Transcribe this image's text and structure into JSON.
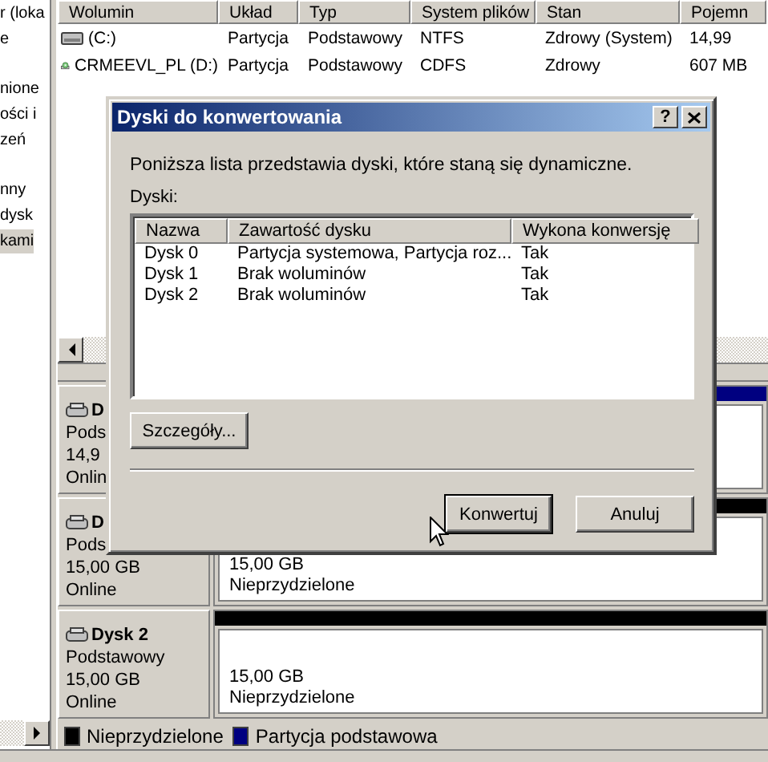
{
  "tree": {
    "items": [
      {
        "label": "r (loka",
        "selected": false
      },
      {
        "label": "e",
        "selected": false
      },
      {
        "label": "nione",
        "selected": false
      },
      {
        "label": "ości i",
        "selected": false
      },
      {
        "label": "zeń",
        "selected": false
      },
      {
        "label": "nny",
        "selected": false
      },
      {
        "label": "dysk",
        "selected": false
      },
      {
        "label": "kami",
        "selected": true
      }
    ]
  },
  "volumes": {
    "columns": [
      "Wolumin",
      "Układ",
      "Typ",
      "System plików",
      "Stan",
      "Pojemn"
    ],
    "rows": [
      {
        "kind": "hdd",
        "cells": [
          "(C:)",
          "Partycja",
          "Podstawowy",
          "NTFS",
          "Zdrowy (System)",
          "14,99"
        ]
      },
      {
        "kind": "cd",
        "cells": [
          "CRMEEVL_PL (D:)",
          "Partycja",
          "Podstawowy",
          "CDFS",
          "Zdrowy",
          "607 MB"
        ]
      }
    ]
  },
  "disks": [
    {
      "name": "D",
      "type": "Pods",
      "size": "14,9",
      "status": "Onlin",
      "partition": {
        "kind": "primary"
      }
    },
    {
      "name": "D",
      "type": "Pods",
      "size": "15,00 GB",
      "status": "Online",
      "partition": {
        "kind": "unallocated",
        "size": "15,00 GB",
        "label": "Nieprzydzielone"
      }
    },
    {
      "name": "Dysk 2",
      "type": "Podstawowy",
      "size": "15,00 GB",
      "status": "Online",
      "partition": {
        "kind": "unallocated",
        "size": "15,00 GB",
        "label": "Nieprzydzielone"
      }
    }
  ],
  "legend": [
    {
      "label": "Nieprzydzielone",
      "color": "#000000"
    },
    {
      "label": "Partycja podstawowa",
      "color": "#000080"
    }
  ],
  "dialog": {
    "title": "Dyski do konwertowania",
    "help": "?",
    "message": "Poniższa lista przedstawia dyski, które staną się dynamiczne.",
    "list_label": "Dyski:",
    "columns": [
      "Nazwa",
      "Zawartość dysku",
      "Wykona konwersję"
    ],
    "rows": [
      [
        "Dysk 0",
        "Partycja systemowa, Partycja roz...",
        "Tak"
      ],
      [
        "Dysk 1",
        "Brak woluminów",
        "Tak"
      ],
      [
        "Dysk 2",
        "Brak woluminów",
        "Tak"
      ]
    ],
    "details_button": "Szczegóły...",
    "buttons": [
      {
        "label": "Konwertuj",
        "default": true
      },
      {
        "label": "Anuluj",
        "default": false
      }
    ]
  }
}
